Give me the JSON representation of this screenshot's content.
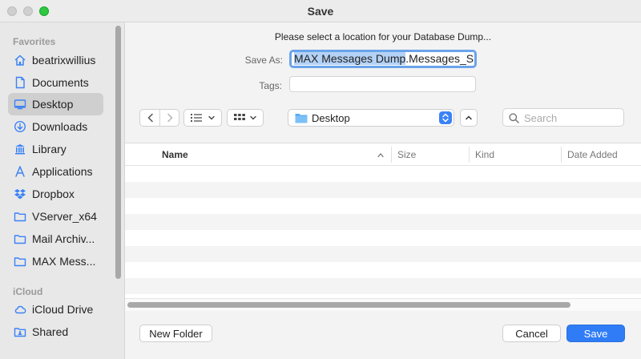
{
  "window": {
    "title": "Save"
  },
  "sidebar": {
    "sections": [
      {
        "title": "Favorites",
        "items": [
          {
            "label": "beatrixwillius",
            "icon": "home-icon",
            "active": false
          },
          {
            "label": "Documents",
            "icon": "document-icon",
            "active": false
          },
          {
            "label": "Desktop",
            "icon": "desktop-icon",
            "active": true
          },
          {
            "label": "Downloads",
            "icon": "download-icon",
            "active": false
          },
          {
            "label": "Library",
            "icon": "library-icon",
            "active": false
          },
          {
            "label": "Applications",
            "icon": "applications-icon",
            "active": false
          },
          {
            "label": "Dropbox",
            "icon": "dropbox-icon",
            "active": false
          },
          {
            "label": "VServer_x64",
            "icon": "folder-icon",
            "active": false
          },
          {
            "label": "Mail Archiv...",
            "icon": "folder-icon",
            "active": false
          },
          {
            "label": "MAX Mess...",
            "icon": "folder-icon",
            "active": false
          }
        ]
      },
      {
        "title": "iCloud",
        "items": [
          {
            "label": "iCloud Drive",
            "icon": "cloud-icon",
            "active": false
          },
          {
            "label": "Shared",
            "icon": "shared-folder-icon",
            "active": false
          }
        ]
      }
    ]
  },
  "dialog": {
    "prompt": "Please select a location for your Database Dump...",
    "save_as_label": "Save As:",
    "save_as_value_selected": "MAX Messages Dump",
    "save_as_value_rest": ".Messages_S(",
    "tags_label": "Tags:",
    "tags_value": ""
  },
  "toolbar": {
    "back_icon": "chevron-left-icon",
    "forward_icon": "chevron-right-icon",
    "list_view_icon": "list-view-icon",
    "grid_view_icon": "grid-view-icon",
    "location": "Desktop",
    "search_placeholder": "Search"
  },
  "file_list": {
    "columns": [
      "Name",
      "Size",
      "Kind",
      "Date Added"
    ],
    "sort_column": "Name",
    "rows": []
  },
  "buttons": {
    "new_folder": "New Folder",
    "cancel": "Cancel",
    "save": "Save"
  },
  "colors": {
    "accent": "#2f7cf6",
    "selection": "#b3d2f6",
    "sidebar_bg": "#e8e8e8",
    "folder": "#5aa9f0"
  }
}
